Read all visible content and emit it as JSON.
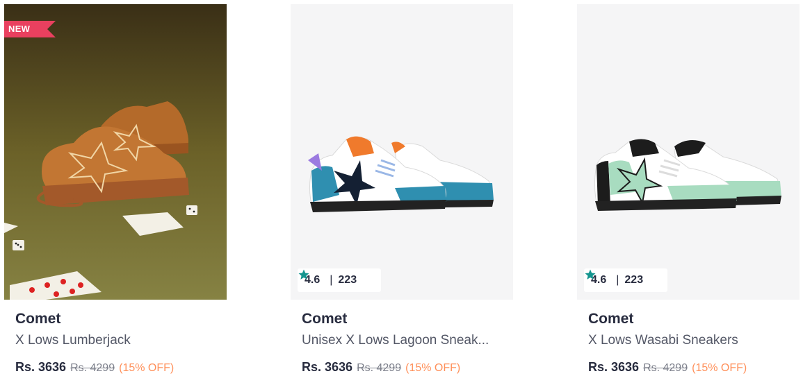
{
  "products": [
    {
      "badge": "NEW",
      "image": "lumberjack-sneakers-image",
      "brand": "Comet",
      "title": "X Lows Lumberjack",
      "price": "Rs. 3636",
      "mrp": "Rs. 4299",
      "discount": "(15% OFF)"
    },
    {
      "image": "lagoon-sneakers-image",
      "rating": "4.6",
      "rating_count": "223",
      "brand": "Comet",
      "title": "Unisex X Lows Lagoon Sneak...",
      "price": "Rs. 3636",
      "mrp": "Rs. 4299",
      "discount": "(15% OFF)"
    },
    {
      "image": "wasabi-sneakers-image",
      "rating": "4.6",
      "rating_count": "223",
      "brand": "Comet",
      "title": "X Lows Wasabi Sneakers",
      "price": "Rs. 3636",
      "mrp": "Rs. 4299",
      "discount": "(15% OFF)"
    }
  ],
  "colors": {
    "badge_bg": "#e9405f",
    "rating_star": "#14958f",
    "discount": "#ff905a",
    "brand_text": "#282c3f"
  },
  "icons": {
    "rating": "star-icon"
  }
}
